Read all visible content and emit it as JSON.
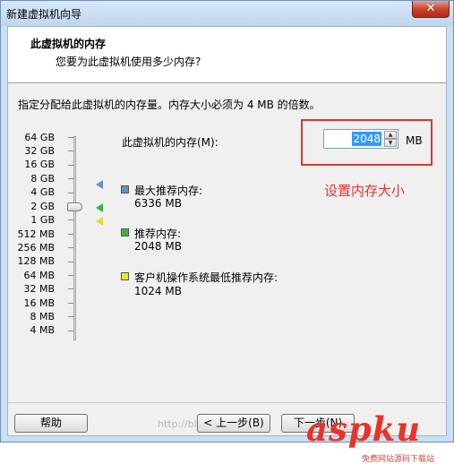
{
  "window": {
    "title": "新建虚拟机向导",
    "close_glyph": "✕"
  },
  "header": {
    "title": "此虚拟机的内存",
    "subtitle": "您要为此虚拟机使用多少内存?"
  },
  "instruction": "指定分配给此虚拟机的内存量。内存大小必须为 4 MB 的倍数。",
  "scale": [
    "64 GB",
    "32 GB",
    "16 GB",
    "8 GB",
    "4 GB",
    "2 GB",
    "1 GB",
    "512 MB",
    "256 MB",
    "128 MB",
    "64 MB",
    "32 MB",
    "16 MB",
    "8 MB",
    "4 MB"
  ],
  "memory": {
    "label": "此虚拟机的内存(M):",
    "value": "2048",
    "unit": "MB",
    "slider_value_mb": 2048
  },
  "annotation": "设置内存大小",
  "legend": [
    {
      "title": "最大推荐内存:",
      "value": "6336 MB",
      "color": "#6a8fc3"
    },
    {
      "title": "推荐内存:",
      "value": "2048 MB",
      "color": "#3cb43c"
    },
    {
      "title": "客户机操作系统最低推荐内存:",
      "value": "1024 MB",
      "color": "#f3e33a"
    }
  ],
  "buttons": {
    "help": "帮助",
    "back": "< 上一步(B)",
    "next": "下一步(N)"
  },
  "watermarks": {
    "text": "http://blog.csdn.net",
    "logo": "aspku",
    "logo_sub": "免费网站源码下载站"
  }
}
